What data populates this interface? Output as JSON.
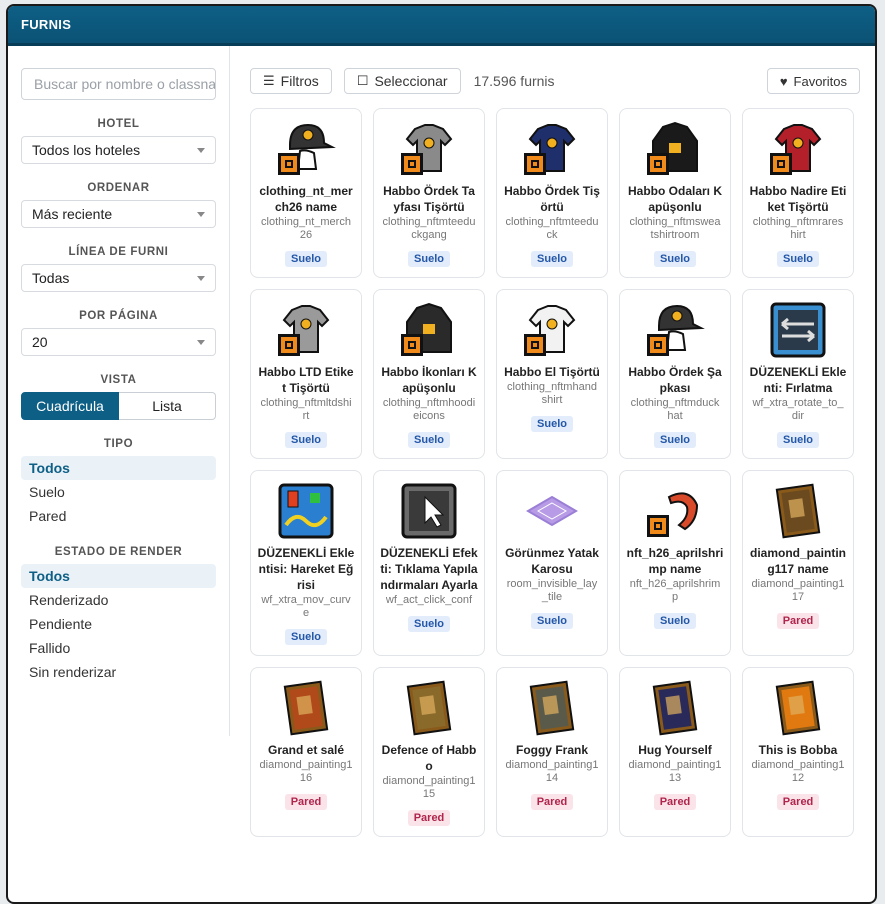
{
  "window": {
    "title": "FURNIS"
  },
  "sidebar": {
    "search_placeholder": "Buscar por nombre o classname",
    "hotel": {
      "label": "HOTEL",
      "value": "Todos los hoteles"
    },
    "order": {
      "label": "ORDENAR",
      "value": "Más reciente"
    },
    "line": {
      "label": "LÍNEA DE FURNI",
      "value": "Todas"
    },
    "per_page": {
      "label": "POR PÁGINA",
      "value": "20"
    },
    "view": {
      "label": "VISTA",
      "grid": "Cuadrícula",
      "list": "Lista"
    },
    "type": {
      "label": "TIPO",
      "options": [
        "Todos",
        "Suelo",
        "Pared"
      ]
    },
    "render": {
      "label": "ESTADO DE RENDER",
      "options": [
        "Todos",
        "Renderizado",
        "Pendiente",
        "Fallido",
        "Sin renderizar"
      ]
    }
  },
  "toolbar": {
    "filters": "Filtros",
    "select": "Seleccionar",
    "count": "17.596 furnis",
    "favorites": "Favoritos"
  },
  "cards": [
    {
      "name": "clothing_nt_merch26 name",
      "class": "clothing_nt_merch26",
      "badge": "Suelo",
      "kind": "floor",
      "icon": "cap-icon",
      "color": "#333333"
    },
    {
      "name": "Habbo Ördek Tayfası Tişörtü",
      "class": "clothing_nftmteeduckgang",
      "badge": "Suelo",
      "kind": "floor",
      "icon": "shirt-icon",
      "color": "#8a8a8a"
    },
    {
      "name": "Habbo Ördek Tişörtü",
      "class": "clothing_nftmteeduck",
      "badge": "Suelo",
      "kind": "floor",
      "icon": "shirt-icon",
      "color": "#1f2f6b"
    },
    {
      "name": "Habbo Odaları Kapüşonlu",
      "class": "clothing_nftmsweatshirtroom",
      "badge": "Suelo",
      "kind": "floor",
      "icon": "hoodie-icon",
      "color": "#1a1a1a"
    },
    {
      "name": "Habbo Nadire Etiket Tişörtü",
      "class": "clothing_nftmrareshirt",
      "badge": "Suelo",
      "kind": "floor",
      "icon": "shirt-icon",
      "color": "#b3202a"
    },
    {
      "name": "Habbo LTD Etiket Tişörtü",
      "class": "clothing_nftmltdshirt",
      "badge": "Suelo",
      "kind": "floor",
      "icon": "shirt-icon",
      "color": "#9a9a9a"
    },
    {
      "name": "Habbo İkonları Kapüşonlu",
      "class": "clothing_nftmhoodieicons",
      "badge": "Suelo",
      "kind": "floor",
      "icon": "hoodie-icon",
      "color": "#2a2a2a"
    },
    {
      "name": "Habbo El Tişörtü",
      "class": "clothing_nftmhandshirt",
      "badge": "Suelo",
      "kind": "floor",
      "icon": "shirt-icon",
      "color": "#f2f2f2"
    },
    {
      "name": "Habbo Ördek Şapkası",
      "class": "clothing_nftmduckhat",
      "badge": "Suelo",
      "kind": "floor",
      "icon": "cap-icon",
      "color": "#333333"
    },
    {
      "name": "DÜZENEKLİ Eklenti: Fırlatma",
      "class": "wf_xtra_rotate_to_dir",
      "badge": "Suelo",
      "kind": "floor",
      "icon": "wired-rotate-icon",
      "color": "#3a8fd0"
    },
    {
      "name": "DÜZENEKLİ Eklentisi: Hareket Eğrisi",
      "class": "wf_xtra_mov_curve",
      "badge": "Suelo",
      "kind": "floor",
      "icon": "wired-curve-icon",
      "color": "#2a7fd0"
    },
    {
      "name": "DÜZENEKLİ Efekti: Tıklama Yapılandırmaları Ayarla",
      "class": "wf_act_click_conf",
      "badge": "Suelo",
      "kind": "floor",
      "icon": "wired-click-icon",
      "color": "#6a6a6a"
    },
    {
      "name": "Görünmez Yatak Karosu",
      "class": "room_invisible_lay_tile",
      "badge": "Suelo",
      "kind": "floor",
      "icon": "tile-icon",
      "color": "#b79be6"
    },
    {
      "name": "nft_h26_aprilshrimp name",
      "class": "nft_h26_aprilshrimp",
      "badge": "Suelo",
      "kind": "floor",
      "icon": "shrimp-icon",
      "color": "#d94a2a"
    },
    {
      "name": "diamond_painting117 name",
      "class": "diamond_painting117",
      "badge": "Pared",
      "kind": "wall",
      "icon": "painting-icon",
      "color": "#6b4a1f"
    },
    {
      "name": "Grand et salé",
      "class": "diamond_painting116",
      "badge": "Pared",
      "kind": "wall",
      "icon": "painting-icon",
      "color": "#b04a1a"
    },
    {
      "name": "Defence of Habbo",
      "class": "diamond_painting115",
      "badge": "Pared",
      "kind": "wall",
      "icon": "painting-icon",
      "color": "#8a6a2a"
    },
    {
      "name": "Foggy Frank",
      "class": "diamond_painting114",
      "badge": "Pared",
      "kind": "wall",
      "icon": "painting-icon",
      "color": "#5a5a4a"
    },
    {
      "name": "Hug Yourself",
      "class": "diamond_painting113",
      "badge": "Pared",
      "kind": "wall",
      "icon": "painting-icon",
      "color": "#2a2a5a"
    },
    {
      "name": "This is Bobba",
      "class": "diamond_painting112",
      "badge": "Pared",
      "kind": "wall",
      "icon": "painting-icon",
      "color": "#e07a10"
    }
  ]
}
